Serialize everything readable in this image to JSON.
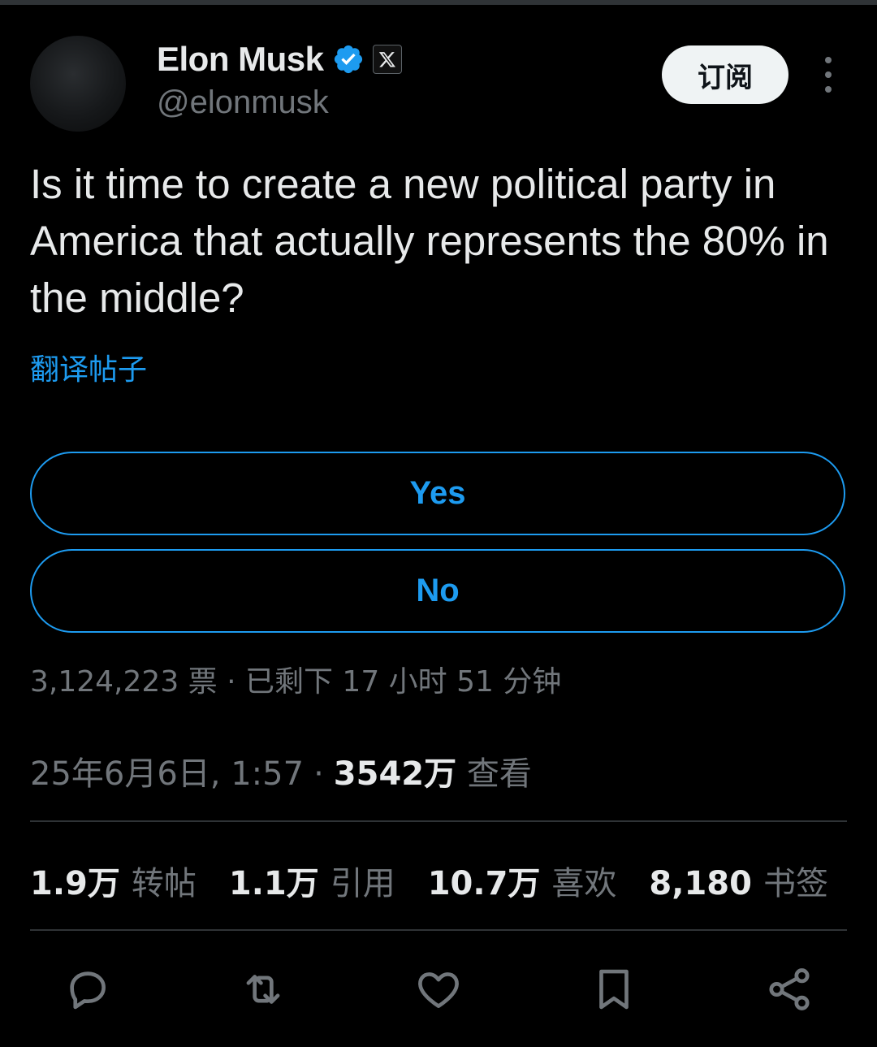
{
  "author": {
    "name": "Elon Musk",
    "handle": "@elonmusk",
    "verified": true,
    "affiliation_icon": "x-logo-icon"
  },
  "header": {
    "subscribe_label": "订阅",
    "more_icon": "more-vertical-icon"
  },
  "tweet": {
    "text": "Is it time to create a new political party in America that actually represents the 80% in the middle?",
    "translate_label": "翻译帖子"
  },
  "poll": {
    "options": [
      "Yes",
      "No"
    ],
    "meta": "3,124,223 票 · 已剩下 17 小时 51 分钟"
  },
  "timestamp": {
    "datetime": "25年6月6日, 1:57",
    "separator": "·",
    "views_count": "3542万",
    "views_label": "查看"
  },
  "stats": [
    {
      "count": "1.9万",
      "label": "转帖"
    },
    {
      "count": "1.1万",
      "label": "引用"
    },
    {
      "count": "10.7万",
      "label": "喜欢"
    },
    {
      "count": "8,180",
      "label": "书签"
    }
  ],
  "actions": [
    "reply-icon",
    "retweet-icon",
    "like-icon",
    "bookmark-icon",
    "share-icon"
  ],
  "colors": {
    "background": "#000000",
    "text_primary": "#e7e9ea",
    "text_secondary": "#71767b",
    "accent": "#1d9bf0",
    "divider": "#2f3336"
  }
}
